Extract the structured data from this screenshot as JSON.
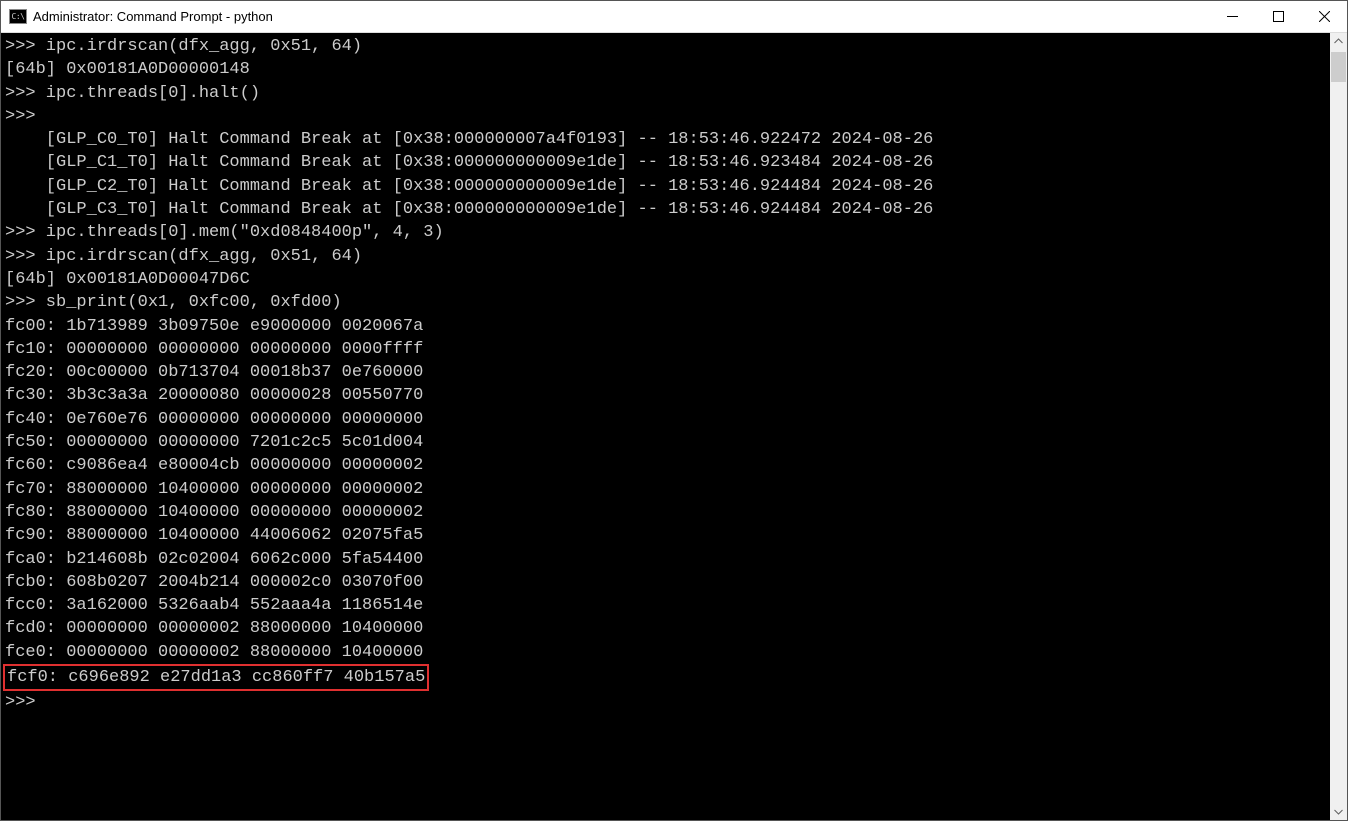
{
  "window": {
    "icon_text": "C:\\",
    "title": "Administrator: Command Prompt - python"
  },
  "terminal": {
    "lines": [
      ">>> ipc.irdrscan(dfx_agg, 0x51, 64)",
      "[64b] 0x00181A0D00000148",
      ">>> ipc.threads[0].halt()",
      ">>>",
      "    [GLP_C0_T0] Halt Command Break at [0x38:000000007a4f0193] -- 18:53:46.922472 2024-08-26",
      "    [GLP_C1_T0] Halt Command Break at [0x38:000000000009e1de] -- 18:53:46.923484 2024-08-26",
      "    [GLP_C2_T0] Halt Command Break at [0x38:000000000009e1de] -- 18:53:46.924484 2024-08-26",
      "    [GLP_C3_T0] Halt Command Break at [0x38:000000000009e1de] -- 18:53:46.924484 2024-08-26",
      ">>> ipc.threads[0].mem(\"0xd0848400p\", 4, 3)",
      ">>> ipc.irdrscan(dfx_agg, 0x51, 64)",
      "[64b] 0x00181A0D00047D6C",
      ">>> sb_print(0x1, 0xfc00, 0xfd00)",
      "fc00: 1b713989 3b09750e e9000000 0020067a",
      "fc10: 00000000 00000000 00000000 0000ffff",
      "fc20: 00c00000 0b713704 00018b37 0e760000",
      "fc30: 3b3c3a3a 20000080 00000028 00550770",
      "fc40: 0e760e76 00000000 00000000 00000000",
      "fc50: 00000000 00000000 7201c2c5 5c01d004",
      "fc60: c9086ea4 e80004cb 00000000 00000002",
      "fc70: 88000000 10400000 00000000 00000002",
      "fc80: 88000000 10400000 00000000 00000002",
      "fc90: 88000000 10400000 44006062 02075fa5",
      "fca0: b214608b 02c02004 6062c000 5fa54400",
      "fcb0: 608b0207 2004b214 000002c0 03070f00",
      "fcc0: 3a162000 5326aab4 552aaa4a 1186514e",
      "fcd0: 00000000 00000002 88000000 10400000",
      "fce0: 00000000 00000002 88000000 10400000"
    ],
    "highlighted_line": "fcf0: c696e892 e27dd1a3 cc860ff7 40b157a5",
    "prompt_line": ">>>"
  }
}
